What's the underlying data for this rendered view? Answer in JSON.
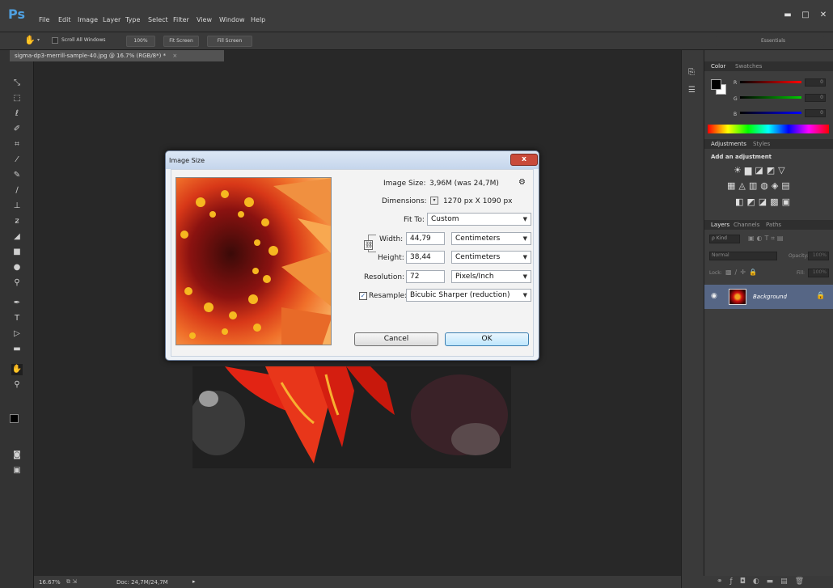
{
  "app": {
    "logo": "Ps"
  },
  "menu": [
    "File",
    "Edit",
    "Image",
    "Layer",
    "Type",
    "Select",
    "Filter",
    "View",
    "Window",
    "Help"
  ],
  "options_bar": {
    "scroll_all_windows": "Scroll All Windows",
    "zoom_100": "100%",
    "fit_screen": "Fit Screen",
    "fill_screen": "Fill Screen",
    "workspace": "Essentials"
  },
  "document": {
    "tab_title": "sigma-dp3-merrill-sample-40.jpg @ 16.7% (RGB/8*) *"
  },
  "status": {
    "zoom": "16.67%",
    "doc_size": "Doc: 24,7M/24,7M"
  },
  "panels": {
    "color_tab": "Color",
    "swatches_tab": "Swatches",
    "rgb_labels": [
      "R",
      "G",
      "B"
    ],
    "rgb_values": [
      "0",
      "0",
      "0"
    ],
    "adjustments_tab": "Adjustments",
    "styles_tab": "Styles",
    "add_adjustment": "Add an adjustment",
    "layers_tab": "Layers",
    "channels_tab": "Channels",
    "paths_tab": "Paths",
    "kind_filter": "ρ Kind",
    "blend_mode": "Normal",
    "opacity_label": "Opacity:",
    "opacity_value": "100%",
    "lock_label": "Lock:",
    "fill_label": "Fill:",
    "fill_value": "100%",
    "layer_name": "Background"
  },
  "dialog": {
    "title": "Image Size",
    "close_glyph": "x",
    "image_size_label": "Image Size:",
    "image_size_value": "3,96M (was 24,7M)",
    "dimensions_label": "Dimensions:",
    "dimensions_value": "1270 px  X  1090 px",
    "fit_to_label": "Fit To:",
    "fit_to_value": "Custom",
    "width_label": "Width:",
    "width_value": "44,79",
    "width_unit": "Centimeters",
    "height_label": "Height:",
    "height_value": "38,44",
    "height_unit": "Centimeters",
    "resolution_label": "Resolution:",
    "resolution_value": "72",
    "resolution_unit": "Pixels/Inch",
    "resample_label": "Resample:",
    "resample_checked": true,
    "resample_value": "Bicubic Sharper (reduction)",
    "cancel_label": "Cancel",
    "ok_label": "OK"
  },
  "colors": {
    "accent": "#4fa0e0",
    "dialog_close": "#c94a3a"
  }
}
